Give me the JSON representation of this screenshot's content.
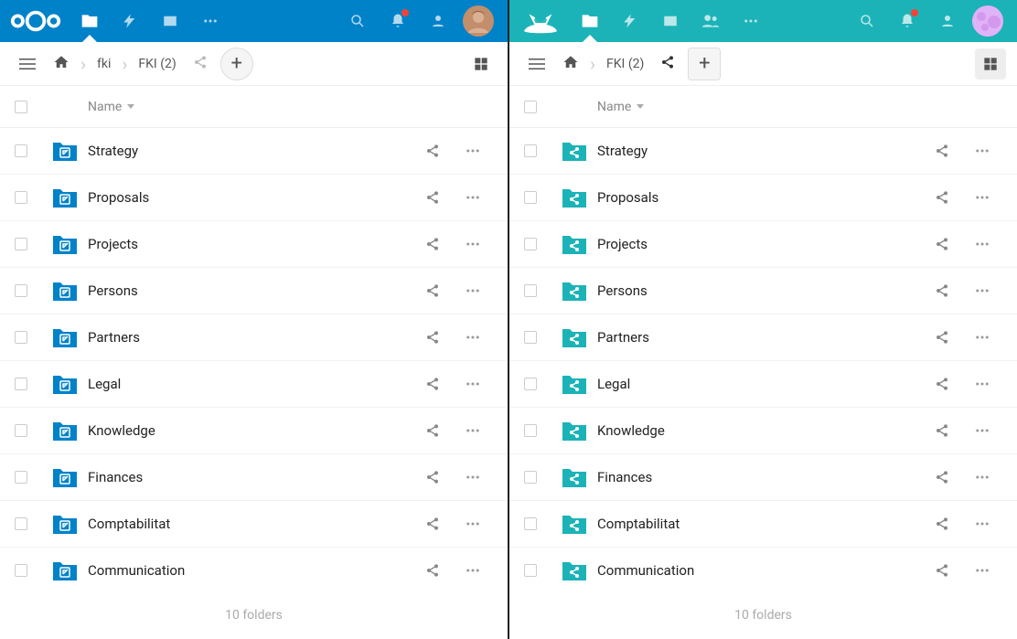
{
  "left": {
    "accent": "#0082c9",
    "breadcrumbs": [
      "fki",
      "FKI (2)"
    ],
    "name_header": "Name",
    "folders": [
      {
        "name": "Strategy"
      },
      {
        "name": "Proposals"
      },
      {
        "name": "Projects"
      },
      {
        "name": "Persons"
      },
      {
        "name": "Partners"
      },
      {
        "name": "Legal"
      },
      {
        "name": "Knowledge"
      },
      {
        "name": "Finances"
      },
      {
        "name": "Comptabilitat"
      },
      {
        "name": "Communication"
      }
    ],
    "footer": "10 folders",
    "bell_dot_color": "#f44336",
    "folder_badge": "external"
  },
  "right": {
    "accent": "#1cb3b8",
    "breadcrumbs": [
      "FKI (2)"
    ],
    "name_header": "Name",
    "folders": [
      {
        "name": "Strategy"
      },
      {
        "name": "Proposals"
      },
      {
        "name": "Projects"
      },
      {
        "name": "Persons"
      },
      {
        "name": "Partners"
      },
      {
        "name": "Legal"
      },
      {
        "name": "Knowledge"
      },
      {
        "name": "Finances"
      },
      {
        "name": "Comptabilitat"
      },
      {
        "name": "Communication"
      }
    ],
    "footer": "10 folders",
    "bell_dot_color": "#f44336",
    "folder_badge": "shared"
  }
}
